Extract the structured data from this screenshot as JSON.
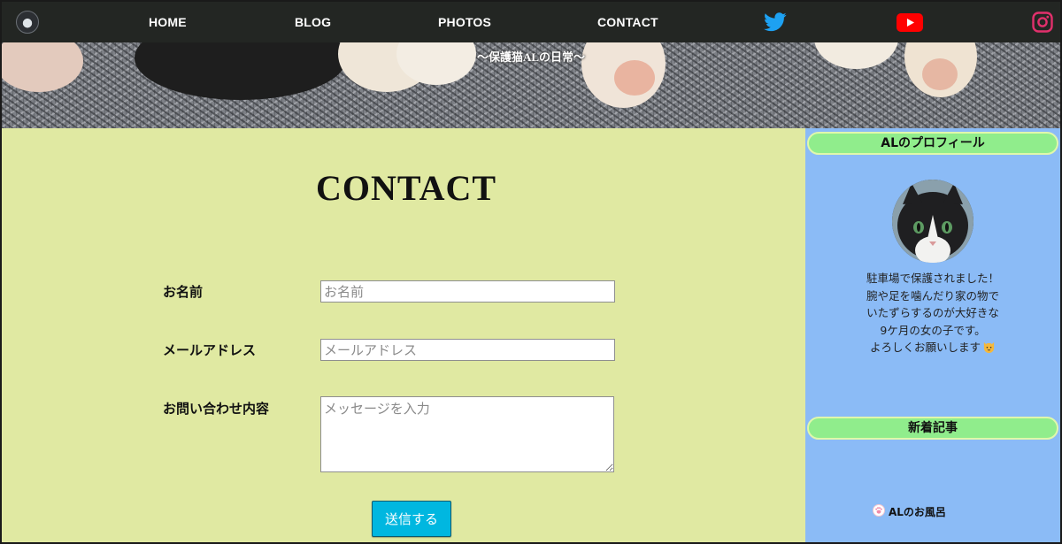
{
  "nav": {
    "items": [
      "HOME",
      "BLOG",
      "PHOTOS",
      "CONTACT"
    ],
    "icons": [
      "logo-avatar",
      "twitter-icon",
      "youtube-icon",
      "instagram-icon"
    ],
    "colors": {
      "bar": "#232623",
      "twitter": "#1da1f2",
      "youtube": "#ff0000",
      "instagram": "#e1306c"
    }
  },
  "header": {
    "subtitle": "〜保護猫ALの日常〜"
  },
  "main": {
    "title": "CONTACT",
    "form": {
      "name_label": "お名前",
      "name_placeholder": "お名前",
      "email_label": "メールアドレス",
      "email_placeholder": "メールアドレス",
      "message_label": "お問い合わせ内容",
      "message_placeholder": "メッセージを入力",
      "submit_label": "送信する"
    },
    "colors": {
      "background": "#e0e9a2",
      "submit": "#00b7e0"
    }
  },
  "sidebar": {
    "profile_heading": "ALのプロフィール",
    "profile_lines": [
      "駐車場で保護されました！",
      "腕や足を噛んだり家の物で",
      "いたずらするのが大好きな",
      "9ケ月の女の子です。",
      "よろしくお願いします"
    ],
    "recent_heading": "新着記事",
    "recent_items": [
      "ALのお風呂"
    ],
    "colors": {
      "background": "#8bbbf6",
      "heading": "#90ed8c"
    }
  }
}
